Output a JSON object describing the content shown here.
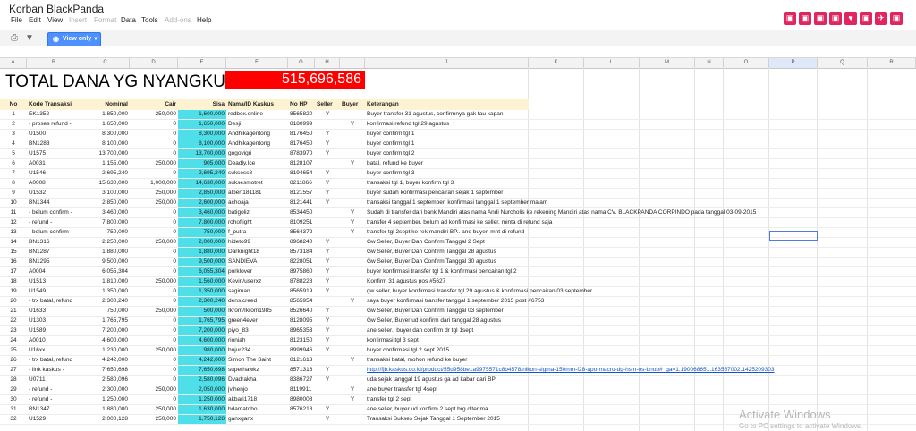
{
  "doc_title": "Korban BlackPanda",
  "menu": [
    "File",
    "Edit",
    "View",
    "Insert",
    "Format",
    "Data",
    "Tools",
    "Add-ons",
    "Help"
  ],
  "view_only_label": "View only",
  "total_label": "TOTAL DANA YG NYANGKUT:",
  "total_value": "515,696,586",
  "columns": [
    "A",
    "B",
    "C",
    "D",
    "E",
    "F",
    "G",
    "H",
    "I",
    "J",
    "K",
    "L",
    "M",
    "N",
    "O",
    "P",
    "Q",
    "R"
  ],
  "headers": {
    "no": "No",
    "kode": "Kode Transaksi",
    "nominal": "Nominal",
    "cair": "Cair",
    "sisa": "Sisa",
    "nama": "Nama/ID Kaskus",
    "hp": "No HP",
    "seller": "Seller",
    "buyer": "Buyer",
    "ket": "Keterangan"
  },
  "rows": [
    {
      "no": "1",
      "kode": "EK1352",
      "nominal": "1,850,000",
      "cair": "250,000",
      "sisa": "1,600,000",
      "nama": "redbox.online",
      "hp": "8565820",
      "seller": "Y",
      "buyer": "",
      "ket": "Buyer transfer 31 agustus, confirmnya gak tau kapan"
    },
    {
      "no": "2",
      "kode": "- proses refund -",
      "nominal": "1,650,000",
      "cair": "0",
      "sisa": "1,650,000",
      "nama": "Desji",
      "hp": "8180999",
      "seller": "",
      "buyer": "Y",
      "ket": "konfirmasi refund tgl 29 agustus"
    },
    {
      "no": "3",
      "kode": "U1500",
      "nominal": "8,300,000",
      "cair": "0",
      "sisa": "8,300,000",
      "nama": "Andhikagentong",
      "hp": "8176450",
      "seller": "Y",
      "buyer": "",
      "ket": "buyer confirm tgl 1"
    },
    {
      "no": "4",
      "kode": "BN1283",
      "nominal": "8,100,000",
      "cair": "0",
      "sisa": "8,100,000",
      "nama": "Andhikagentong",
      "hp": "8176450",
      "seller": "Y",
      "buyer": "",
      "ket": "buyer confirm tgl 1"
    },
    {
      "no": "5",
      "kode": "U1575",
      "nominal": "13,700,000",
      "cair": "0",
      "sisa": "13,700,000",
      "nama": "gogovigri",
      "hp": "8783970",
      "seller": "Y",
      "buyer": "",
      "ket": "buyer confirm tgl 2"
    },
    {
      "no": "6",
      "kode": "A0031",
      "nominal": "1,155,000",
      "cair": "250,000",
      "sisa": "905,000",
      "nama": "Deadly.Ice",
      "hp": "8128107",
      "seller": "",
      "buyer": "Y",
      "ket": "batal, refund ke buyer"
    },
    {
      "no": "7",
      "kode": "U1546",
      "nominal": "2,695,240",
      "cair": "0",
      "sisa": "2,695,240",
      "nama": "suksess8",
      "hp": "8194654",
      "seller": "Y",
      "buyer": "",
      "ket": "buyer confirm tgl 3"
    },
    {
      "no": "8",
      "kode": "A0008",
      "nominal": "15,630,000",
      "cair": "1,000,000",
      "sisa": "14,630,000",
      "nama": "suksesmotret",
      "hp": "8211866",
      "seller": "Y",
      "buyer": "",
      "ket": "transaksi tgl 1, buyer konfirm tgl 3"
    },
    {
      "no": "9",
      "kode": "U1532",
      "nominal": "3,100,000",
      "cair": "250,000",
      "sisa": "2,850,000",
      "nama": "albert181181",
      "hp": "8121557",
      "seller": "Y",
      "buyer": "",
      "ket": "buyer sudah konfirmasi pencairan sejak 1 september"
    },
    {
      "no": "10",
      "kode": "BN1344",
      "nominal": "2,850,000",
      "cair": "250,000",
      "sisa": "2,600,000",
      "nama": "achoaja",
      "hp": "8121441",
      "seller": "Y",
      "buyer": "",
      "ket": "transaksi tanggal 1 september, konfirmasi tanggal 1 september malam"
    },
    {
      "no": "11",
      "kode": "- belum confirm -",
      "nominal": "3,460,000",
      "cair": "0",
      "sisa": "3,460,000",
      "nama": "batigoliz",
      "hp": "8534450",
      "seller": "",
      "buyer": "Y",
      "ket": "Sudah di transfer dari bank Mandiri atas nama Andi Nurcholis ke rekening Mandiri atas nama CV. BLACKPANDA CORPINDO pada tanggal 03-09-2015"
    },
    {
      "no": "12",
      "kode": "- refund -",
      "nominal": "7,800,000",
      "cair": "0",
      "sisa": "7,800,000",
      "nama": "rohoflight",
      "hp": "8109251",
      "seller": "",
      "buyer": "Y",
      "ket": "transfer 4 september, belum ad konfirmasi ke seller, minta di refund saja"
    },
    {
      "no": "13",
      "kode": "- belum confirm -",
      "nominal": "750,000",
      "cair": "0",
      "sisa": "750,000",
      "nama": "f_putra",
      "hp": "8564372",
      "seller": "",
      "buyer": "Y",
      "ket": "transfer tgl 2sept ke rek mandiri BP.. ane buyer, mnt di refund"
    },
    {
      "no": "14",
      "kode": "BN1316",
      "nominal": "2,250,000",
      "cair": "250,000",
      "sisa": "2,000,000",
      "nama": "hideto99",
      "hp": "8968240",
      "seller": "Y",
      "buyer": "",
      "ket": "Gw Seller, Buyer Dah Confirm Tanggal 2 Sept"
    },
    {
      "no": "15",
      "kode": "BN1287",
      "nominal": "1,880,000",
      "cair": "0",
      "sisa": "1,880,000",
      "nama": "Darknight18",
      "hp": "8573184",
      "seller": "Y",
      "buyer": "",
      "ket": "Gw Seller, Buyer Dah Confirm Tanggal 28 agustus"
    },
    {
      "no": "16",
      "kode": "BN1295",
      "nominal": "9,500,000",
      "cair": "0",
      "sisa": "9,500,000",
      "nama": "SANDIEVA",
      "hp": "8228051",
      "seller": "Y",
      "buyer": "",
      "ket": "Gw Seller, Buyer Dah Confirm Tanggal 30 agustus"
    },
    {
      "no": "17",
      "kode": "A0004",
      "nominal": "6,055,304",
      "cair": "0",
      "sisa": "6,055,304",
      "nama": "porklover",
      "hp": "8975860",
      "seller": "Y",
      "buyer": "",
      "ket": "buyer konfirmasi transfer tgl 1 & konfirmasi pencairan tgl 2"
    },
    {
      "no": "18",
      "kode": "U1513",
      "nominal": "1,810,000",
      "cair": "250,000",
      "sisa": "1,560,000",
      "nama": "Kevin/userxz",
      "hp": "8788228",
      "seller": "Y",
      "buyer": "",
      "ket": "Konfirm 31 agustus pos #5627"
    },
    {
      "no": "19",
      "kode": "U1549",
      "nominal": "1,350,000",
      "cair": "0",
      "sisa": "1,350,000",
      "nama": "sagiman",
      "hp": "8565919",
      "seller": "Y",
      "buyer": "",
      "ket": "gw seller, buyer konfirmasi transfer tgl 29 agustus & konfirmasi pencairan 03 september"
    },
    {
      "no": "20",
      "kode": "- trx batal, refund",
      "nominal": "2,300,240",
      "cair": "0",
      "sisa": "2,300,240",
      "nama": "dens.creed",
      "hp": "8565954",
      "seller": "",
      "buyer": "Y",
      "ket": "saya buyer konfirmasi transfer tanggal 1 september 2015 post #6753"
    },
    {
      "no": "21",
      "kode": "U1633",
      "nominal": "750,000",
      "cair": "250,000",
      "sisa": "500,000",
      "nama": "Ikrom/Ikrom1985",
      "hp": "8526640",
      "seller": "Y",
      "buyer": "",
      "ket": "Gw Seller, Buyer Dah Confirm Tanggal 03 september"
    },
    {
      "no": "22",
      "kode": "U1303",
      "nominal": "1,765,795",
      "cair": "0",
      "sisa": "1,765,795",
      "nama": "green4ever",
      "hp": "8128095",
      "seller": "Y",
      "buyer": "",
      "ket": "Gw Seller, Buyer ud konfirm dari tanggal 28 agustus"
    },
    {
      "no": "23",
      "kode": "U1589",
      "nominal": "7,200,000",
      "cair": "0",
      "sisa": "7,200,000",
      "nama": "piyo_83",
      "hp": "8965353",
      "seller": "Y",
      "buyer": "",
      "ket": "ane seller.. buyer dah confirm dr tgl 1sept"
    },
    {
      "no": "24",
      "kode": "A0010",
      "nominal": "4,600,000",
      "cair": "0",
      "sisa": "4,600,000",
      "nama": "rioniah",
      "hp": "8123150",
      "seller": "Y",
      "buyer": "",
      "ket": "konfirmasi tgl 3 sept"
    },
    {
      "no": "25",
      "kode": "U16xx",
      "nominal": "1,230,000",
      "cair": "250,000",
      "sisa": "980,000",
      "nama": "bujur234",
      "hp": "8999946",
      "seller": "Y",
      "buyer": "",
      "ket": "buyer confirmasi tgl 2 sept 2015"
    },
    {
      "no": "26",
      "kode": "- trx batal, refund",
      "nominal": "4,242,000",
      "cair": "0",
      "sisa": "4,242,000",
      "nama": "Simon The Saint",
      "hp": "8121613",
      "seller": "",
      "buyer": "Y",
      "ket": "transaksi batal, mohon refund ke buyer"
    },
    {
      "no": "27",
      "kode": "- link kaskus -",
      "nominal": "7,650,698",
      "cair": "0",
      "sisa": "7,650,698",
      "nama": "superhawkz",
      "hp": "8571316",
      "seller": "Y",
      "buyer": "",
      "ket": "http://fjb.kaskus.co.id/product/55d958be1a9975571c8b4578/nikon-sigma-150mm-f28-apo-macro-dg-hsm-os-bnob#_ga=1.190068651.163557002.1425209303",
      "link": true
    },
    {
      "no": "28",
      "kode": "U0711",
      "nominal": "2,580,096",
      "cair": "0",
      "sisa": "2,580,096",
      "nama": "Dvadrakha",
      "hp": "8386727",
      "seller": "Y",
      "buyer": "",
      "ket": "uda sejak tanggal 19 agustus ga ad kabar dari BP"
    },
    {
      "no": "29",
      "kode": "- refund -",
      "nominal": "2,300,000",
      "cair": "250,000",
      "sisa": "2,050,000",
      "nama": "jv.henjo",
      "hp": "8119911",
      "seller": "",
      "buyer": "Y",
      "ket": "ane buyer transfer tgl 4sept"
    },
    {
      "no": "30",
      "kode": "- refund -",
      "nominal": "1,250,000",
      "cair": "0",
      "sisa": "1,250,000",
      "nama": "akbari1718",
      "hp": "8980008",
      "seller": "",
      "buyer": "Y",
      "ket": "transfer tgl 2 sept"
    },
    {
      "no": "31",
      "kode": "BN1347",
      "nominal": "1,880,000",
      "cair": "250,000",
      "sisa": "1,630,000",
      "nama": "bdamatobo",
      "hp": "8576213",
      "seller": "Y",
      "buyer": "",
      "ket": "ane seller, buyer ud konfirm 2 sept brg diterima"
    },
    {
      "no": "32",
      "kode": "U1529",
      "nominal": "2,000,128",
      "cair": "250,000",
      "sisa": "1,750,128",
      "nama": "ganxganx",
      "hp": "",
      "seller": "Y",
      "buyer": "",
      "ket": "Transaksi Sukses Sejak Tanggal 1 September 2015"
    }
  ],
  "watermark": {
    "title": "Activate Windows",
    "subtitle": "Go to PC settings to activate Windows."
  }
}
